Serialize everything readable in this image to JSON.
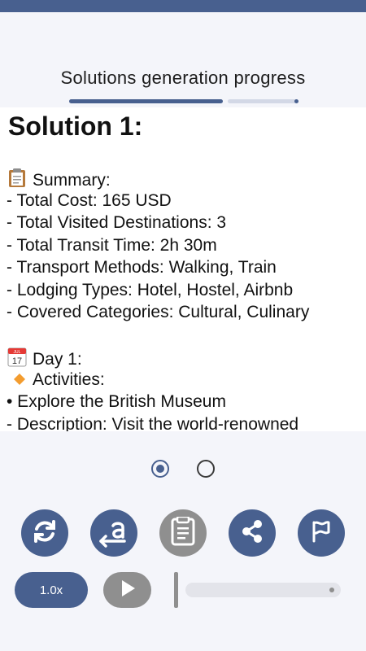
{
  "header": {
    "progress_title": "Solutions generation progress",
    "progress_fraction": 0.68
  },
  "content": {
    "solution_title": "Solution 1:",
    "summary_icon": "clipboard-emoji",
    "summary_heading": "Summary:",
    "summary_lines": [
      "- Total Cost: 165 USD",
      "- Total Visited Destinations: 3",
      "- Total Transit Time: 2h 30m",
      "- Transport Methods: Walking, Train",
      "- Lodging Types: Hotel, Hostel, Airbnb",
      "- Covered Categories: Cultural, Culinary"
    ],
    "calendar_icon": "calendar-emoji",
    "calendar_icon_text": "17",
    "calendar_icon_month": "JUL",
    "day_heading": "Day 1:",
    "activities_icon": "orange-diamond-emoji",
    "activities_heading": "Activities:",
    "activity_lines": [
      "• Explore the British Museum",
      "- Description: Visit the world-renowned"
    ]
  },
  "pager": {
    "pages": 2,
    "selected_index": 0
  },
  "actions": [
    {
      "name": "refresh-button",
      "icon": "refresh-icon",
      "enabled": true
    },
    {
      "name": "translate-button",
      "icon": "translate-icon",
      "enabled": true
    },
    {
      "name": "copy-button",
      "icon": "document-icon",
      "enabled": false
    },
    {
      "name": "share-button",
      "icon": "share-icon",
      "enabled": true
    },
    {
      "name": "report-button",
      "icon": "flag-icon",
      "enabled": true
    }
  ],
  "player": {
    "speed_label": "1.0x",
    "play_icon": "play-icon",
    "progress": 0
  },
  "colors": {
    "accent": "#48608f",
    "disabled": "#8f8f8f"
  }
}
